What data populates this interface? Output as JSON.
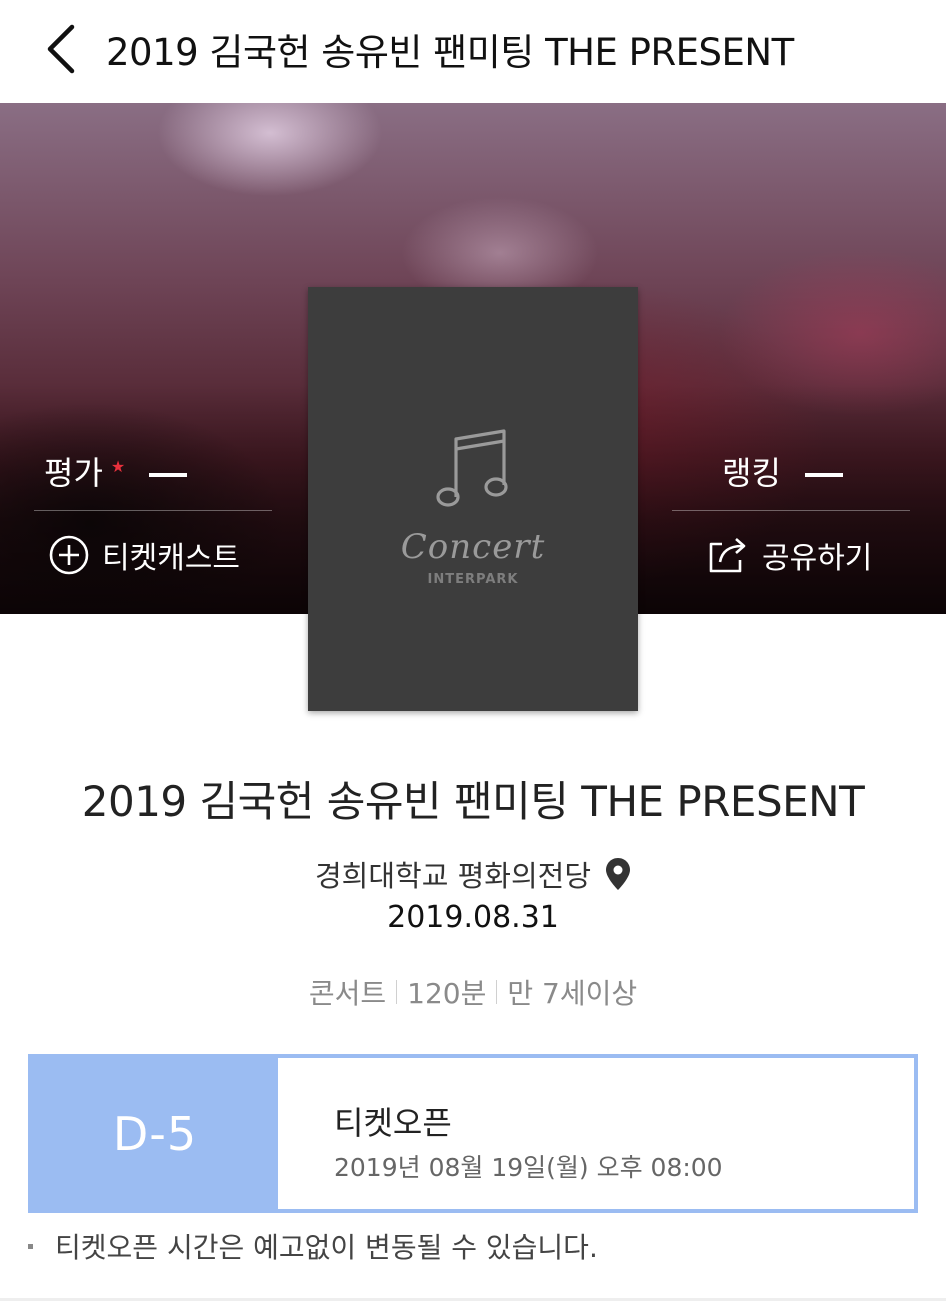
{
  "header": {
    "title": "2019 김국헌 송유빈 팬미팅 THE PRESENT",
    "back_icon": "chevron-left-icon"
  },
  "hero": {
    "rating_label": "평가",
    "rating_value": "--",
    "ranking_label": "랭킹",
    "ranking_value": "--",
    "ticketcast_label": "티켓캐스트",
    "share_label": "공유하기",
    "star_color": "#e8303c"
  },
  "poster": {
    "word": "Concert",
    "brand": "INTERPARK",
    "icon": "music-note-icon"
  },
  "event": {
    "title": "2019 김국헌 송유빈 팬미팅 THE PRESENT",
    "venue": "경희대학교 평화의전당",
    "date": "2019.08.31",
    "genre": "콘서트",
    "duration": "120분",
    "age": "만 7세이상"
  },
  "ticket_open": {
    "dday": "D-5",
    "label": "티켓오픈",
    "time": "2019년 08월 19일(월) 오후 08:00",
    "accent_color": "#9bbcf2"
  },
  "notice": {
    "text": "티켓오픈 시간은 예고없이 변동될 수 있습니다."
  }
}
